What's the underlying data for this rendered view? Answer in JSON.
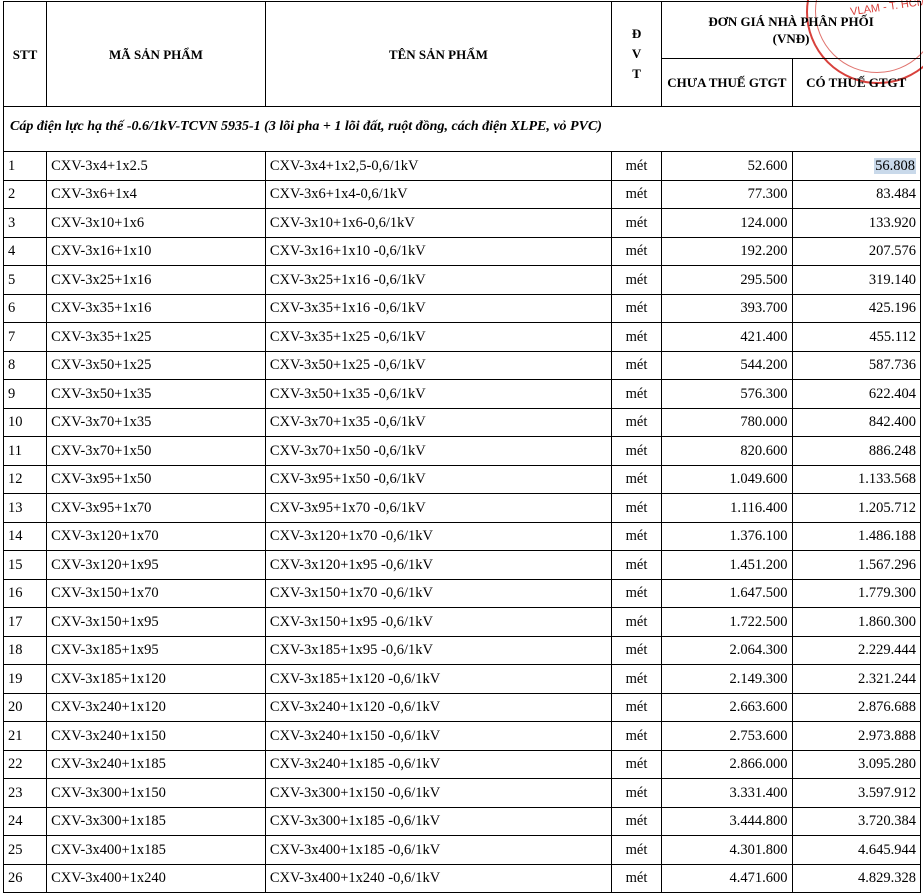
{
  "headers": {
    "stt": "STT",
    "code": "MÃ SẢN PHẨM",
    "name": "TÊN SẢN PHẨM",
    "unit_letters": [
      "Đ",
      "V",
      "T"
    ],
    "price_group": "ĐƠN GIÁ NHÀ PHÂN PHỐI",
    "price_currency": "(VNĐ)",
    "price_before_tax": "CHƯA THUẾ GTGT",
    "price_after_tax": "CÓ THUẾ GTGT"
  },
  "section_title": "Cáp điện lực hạ thế -0.6/1kV-TCVN 5935-1 (3 lõi pha + 1 lõi đất, ruột đồng, cách điện XLPE, vỏ PVC)",
  "stamp_text": "VLAM - T. HCM",
  "rows": [
    {
      "stt": "1",
      "code": "CXV-3x4+1x2.5",
      "name": "CXV-3x4+1x2,5-0,6/1kV",
      "unit": "mét",
      "price": "52.600",
      "price_vat": "56.808"
    },
    {
      "stt": "2",
      "code": "CXV-3x6+1x4",
      "name": "CXV-3x6+1x4-0,6/1kV",
      "unit": "mét",
      "price": "77.300",
      "price_vat": "83.484"
    },
    {
      "stt": "3",
      "code": "CXV-3x10+1x6",
      "name": "CXV-3x10+1x6-0,6/1kV",
      "unit": "mét",
      "price": "124.000",
      "price_vat": "133.920"
    },
    {
      "stt": "4",
      "code": "CXV-3x16+1x10",
      "name": "CXV-3x16+1x10 -0,6/1kV",
      "unit": "mét",
      "price": "192.200",
      "price_vat": "207.576"
    },
    {
      "stt": "5",
      "code": "CXV-3x25+1x16",
      "name": "CXV-3x25+1x16 -0,6/1kV",
      "unit": "mét",
      "price": "295.500",
      "price_vat": "319.140"
    },
    {
      "stt": "6",
      "code": "CXV-3x35+1x16",
      "name": "CXV-3x35+1x16 -0,6/1kV",
      "unit": "mét",
      "price": "393.700",
      "price_vat": "425.196"
    },
    {
      "stt": "7",
      "code": "CXV-3x35+1x25",
      "name": "CXV-3x35+1x25 -0,6/1kV",
      "unit": "mét",
      "price": "421.400",
      "price_vat": "455.112"
    },
    {
      "stt": "8",
      "code": "CXV-3x50+1x25",
      "name": "CXV-3x50+1x25 -0,6/1kV",
      "unit": "mét",
      "price": "544.200",
      "price_vat": "587.736"
    },
    {
      "stt": "9",
      "code": "CXV-3x50+1x35",
      "name": "CXV-3x50+1x35 -0,6/1kV",
      "unit": "mét",
      "price": "576.300",
      "price_vat": "622.404"
    },
    {
      "stt": "10",
      "code": "CXV-3x70+1x35",
      "name": "CXV-3x70+1x35 -0,6/1kV",
      "unit": "mét",
      "price": "780.000",
      "price_vat": "842.400"
    },
    {
      "stt": "11",
      "code": "CXV-3x70+1x50",
      "name": "CXV-3x70+1x50 -0,6/1kV",
      "unit": "mét",
      "price": "820.600",
      "price_vat": "886.248"
    },
    {
      "stt": "12",
      "code": "CXV-3x95+1x50",
      "name": "CXV-3x95+1x50 -0,6/1kV",
      "unit": "mét",
      "price": "1.049.600",
      "price_vat": "1.133.568"
    },
    {
      "stt": "13",
      "code": "CXV-3x95+1x70",
      "name": "CXV-3x95+1x70 -0,6/1kV",
      "unit": "mét",
      "price": "1.116.400",
      "price_vat": "1.205.712"
    },
    {
      "stt": "14",
      "code": "CXV-3x120+1x70",
      "name": "CXV-3x120+1x70 -0,6/1kV",
      "unit": "mét",
      "price": "1.376.100",
      "price_vat": "1.486.188"
    },
    {
      "stt": "15",
      "code": "CXV-3x120+1x95",
      "name": "CXV-3x120+1x95 -0,6/1kV",
      "unit": "mét",
      "price": "1.451.200",
      "price_vat": "1.567.296"
    },
    {
      "stt": "16",
      "code": "CXV-3x150+1x70",
      "name": "CXV-3x150+1x70 -0,6/1kV",
      "unit": "mét",
      "price": "1.647.500",
      "price_vat": "1.779.300"
    },
    {
      "stt": "17",
      "code": "CXV-3x150+1x95",
      "name": "CXV-3x150+1x95 -0,6/1kV",
      "unit": "mét",
      "price": "1.722.500",
      "price_vat": "1.860.300"
    },
    {
      "stt": "18",
      "code": "CXV-3x185+1x95",
      "name": "CXV-3x185+1x95 -0,6/1kV",
      "unit": "mét",
      "price": "2.064.300",
      "price_vat": "2.229.444"
    },
    {
      "stt": "19",
      "code": "CXV-3x185+1x120",
      "name": "CXV-3x185+1x120 -0,6/1kV",
      "unit": "mét",
      "price": "2.149.300",
      "price_vat": "2.321.244"
    },
    {
      "stt": "20",
      "code": "CXV-3x240+1x120",
      "name": "CXV-3x240+1x120 -0,6/1kV",
      "unit": "mét",
      "price": "2.663.600",
      "price_vat": "2.876.688"
    },
    {
      "stt": "21",
      "code": "CXV-3x240+1x150",
      "name": "CXV-3x240+1x150 -0,6/1kV",
      "unit": "mét",
      "price": "2.753.600",
      "price_vat": "2.973.888"
    },
    {
      "stt": "22",
      "code": "CXV-3x240+1x185",
      "name": "CXV-3x240+1x185 -0,6/1kV",
      "unit": "mét",
      "price": "2.866.000",
      "price_vat": "3.095.280"
    },
    {
      "stt": "23",
      "code": "CXV-3x300+1x150",
      "name": "CXV-3x300+1x150 -0,6/1kV",
      "unit": "mét",
      "price": "3.331.400",
      "price_vat": "3.597.912"
    },
    {
      "stt": "24",
      "code": "CXV-3x300+1x185",
      "name": "CXV-3x300+1x185 -0,6/1kV",
      "unit": "mét",
      "price": "3.444.800",
      "price_vat": "3.720.384"
    },
    {
      "stt": "25",
      "code": "CXV-3x400+1x185",
      "name": "CXV-3x400+1x185 -0,6/1kV",
      "unit": "mét",
      "price": "4.301.800",
      "price_vat": "4.645.944"
    },
    {
      "stt": "26",
      "code": "CXV-3x400+1x240",
      "name": "CXV-3x400+1x240 -0,6/1kV",
      "unit": "mét",
      "price": "4.471.600",
      "price_vat": "4.829.328"
    }
  ],
  "selection": {
    "row_index": 0,
    "column": "price_vat",
    "highlight_color": "#c9d9ea"
  },
  "colors": {
    "stamp": "#d8413c",
    "grid": "#000000"
  }
}
